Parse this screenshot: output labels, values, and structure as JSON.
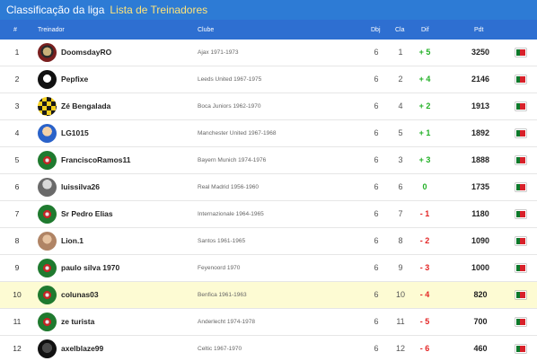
{
  "topbar": {
    "active_tab": "Classificação da liga",
    "link_tab": "Lista de Treinadores"
  },
  "columns": {
    "pos": "#",
    "coach": "Treinador",
    "club": "Clube",
    "played": "Dbj",
    "rank": "Cla",
    "diff": "Dif",
    "points": "Pdt"
  },
  "colors": {
    "header_blue": "#2e6fd1",
    "topbar_blue": "#2d7bd5",
    "link_yellow": "#ffe47a",
    "highlight_row": "#fdfbd3",
    "positive": "#22b026",
    "negative": "#e32424"
  },
  "rows": [
    {
      "pos": "1",
      "name": "DoomsdayRO",
      "club": "Ajax 1971-1973",
      "played": "6",
      "rank": "1",
      "diff": "+ 5",
      "points": "3250",
      "avatar": "doomsday-avatar",
      "flag": "portugal-flag"
    },
    {
      "pos": "2",
      "name": "Pepfixe",
      "club": "Leeds United 1967-1975",
      "played": "6",
      "rank": "2",
      "diff": "+ 4",
      "points": "2146",
      "avatar": "skull-avatar",
      "flag": "portugal-flag"
    },
    {
      "pos": "3",
      "name": "Zé Bengalada",
      "club": "Boca Juniors 1962-1970",
      "played": "6",
      "rank": "4",
      "diff": "+ 2",
      "points": "1913",
      "avatar": "checkered-avatar",
      "flag": "portugal-flag"
    },
    {
      "pos": "4",
      "name": "LG1015",
      "club": "Manchester United 1967-1968",
      "played": "6",
      "rank": "5",
      "diff": "+ 1",
      "points": "1892",
      "avatar": "cartoon-avatar",
      "flag": "portugal-flag"
    },
    {
      "pos": "5",
      "name": "FranciscoRamos11",
      "club": "Bayern Munich 1974-1976",
      "played": "6",
      "rank": "3",
      "diff": "+ 3",
      "points": "1888",
      "avatar": "crest-avatar",
      "flag": "portugal-flag"
    },
    {
      "pos": "6",
      "name": "luissilva26",
      "club": "Real Madrid 1956-1960",
      "played": "6",
      "rank": "6",
      "diff": "0",
      "points": "1735",
      "avatar": "player-avatar",
      "flag": "portugal-flag"
    },
    {
      "pos": "7",
      "name": "Sr Pedro Elias",
      "club": "Internazionale 1964-1965",
      "played": "6",
      "rank": "7",
      "diff": "- 1",
      "points": "1180",
      "avatar": "crest-avatar",
      "flag": "portugal-flag"
    },
    {
      "pos": "8",
      "name": "Lion.1",
      "club": "Santos 1961-1965",
      "played": "6",
      "rank": "8",
      "diff": "- 2",
      "points": "1090",
      "avatar": "photo-avatar",
      "flag": "portugal-flag"
    },
    {
      "pos": "9",
      "name": "paulo silva 1970",
      "club": "Feyenoord 1970",
      "played": "6",
      "rank": "9",
      "diff": "- 3",
      "points": "1000",
      "avatar": "crest-avatar",
      "flag": "portugal-flag"
    },
    {
      "pos": "10",
      "name": "colunas03",
      "club": "Benfica 1961-1963",
      "played": "6",
      "rank": "10",
      "diff": "- 4",
      "points": "820",
      "avatar": "crest-avatar",
      "flag": "portugal-flag",
      "highlight": true
    },
    {
      "pos": "11",
      "name": "ze turista",
      "club": "Anderlecht 1974-1978",
      "played": "6",
      "rank": "11",
      "diff": "- 5",
      "points": "700",
      "avatar": "crest-avatar",
      "flag": "portugal-flag"
    },
    {
      "pos": "12",
      "name": "axelblaze99",
      "club": "Celtic 1967-1970",
      "played": "6",
      "rank": "12",
      "diff": "- 6",
      "points": "460",
      "avatar": "dark-avatar",
      "flag": "portugal-flag"
    }
  ]
}
